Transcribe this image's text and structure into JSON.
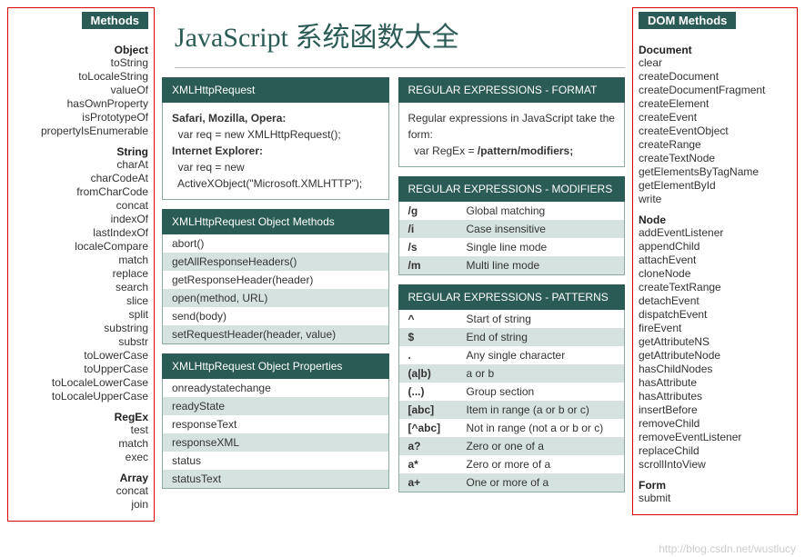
{
  "left_sidebar": {
    "header": "Methods",
    "groups": [
      {
        "title": "Object",
        "items": [
          "toString",
          "toLocaleString",
          "valueOf",
          "hasOwnProperty",
          "isPrototypeOf",
          "propertyIsEnumerable"
        ]
      },
      {
        "title": "String",
        "items": [
          "charAt",
          "charCodeAt",
          "fromCharCode",
          "concat",
          "indexOf",
          "lastIndexOf",
          "localeCompare",
          "match",
          "replace",
          "search",
          "slice",
          "split",
          "substring",
          "substr",
          "toLowerCase",
          "toUpperCase",
          "toLocaleLowerCase",
          "toLocaleUpperCase"
        ]
      },
      {
        "title": "RegEx",
        "items": [
          "test",
          "match",
          "exec"
        ]
      },
      {
        "title": "Array",
        "items": [
          "concat",
          "join"
        ]
      }
    ]
  },
  "right_sidebar": {
    "header": "DOM Methods",
    "groups": [
      {
        "title": "Document",
        "items": [
          "clear",
          "createDocument",
          "createDocumentFragment",
          "createElement",
          "createEvent",
          "createEventObject",
          "createRange",
          "createTextNode",
          "getElementsByTagName",
          "getElementById",
          "write"
        ]
      },
      {
        "title": "Node",
        "items": [
          "addEventListener",
          "appendChild",
          "attachEvent",
          "cloneNode",
          "createTextRange",
          "detachEvent",
          "dispatchEvent",
          "fireEvent",
          "getAttributeNS",
          "getAttributeNode",
          "hasChildNodes",
          "hasAttribute",
          "hasAttributes",
          "insertBefore",
          "removeChild",
          "removeEventListener",
          "replaceChild",
          "scrollIntoView"
        ]
      },
      {
        "title": "Form",
        "items": [
          "submit"
        ]
      }
    ]
  },
  "page_title": "JavaScript 系统函数大全",
  "left_col": {
    "xhr": {
      "header": "XMLHttpRequest",
      "lines": [
        {
          "bold": true,
          "text": "Safari, Mozilla, Opera:"
        },
        {
          "bold": false,
          "text": "  var req = new XMLHttpRequest();"
        },
        {
          "bold": true,
          "text": "Internet Explorer:"
        },
        {
          "bold": false,
          "text": "  var req = new"
        },
        {
          "bold": false,
          "text": "  ActiveXObject(\"Microsoft.XMLHTTP\");"
        }
      ]
    },
    "xhr_methods": {
      "header": "XMLHttpRequest Object Methods",
      "items": [
        "abort()",
        "getAllResponseHeaders()",
        "getResponseHeader(header)",
        "open(method, URL)",
        "send(body)",
        "setRequestHeader(header, value)"
      ]
    },
    "xhr_props": {
      "header": "XMLHttpRequest Object Properties",
      "items": [
        "onreadystatechange",
        "readyState",
        "responseText",
        "responseXML",
        "status",
        "statusText"
      ]
    }
  },
  "right_col": {
    "format": {
      "header": "REGULAR EXPRESSIONS - FORMAT",
      "line1": "Regular expressions in JavaScript take the form:",
      "line2_pre": "  var RegEx = ",
      "line2_bold": "/pattern/modifiers;"
    },
    "modifiers": {
      "header": "REGULAR EXPRESSIONS - MODIFIERS",
      "rows": [
        {
          "k": "/g",
          "v": "Global matching"
        },
        {
          "k": "/i",
          "v": "Case insensitive"
        },
        {
          "k": "/s",
          "v": "Single line mode"
        },
        {
          "k": "/m",
          "v": "Multi line mode"
        }
      ]
    },
    "patterns": {
      "header": "REGULAR EXPRESSIONS - PATTERNS",
      "rows": [
        {
          "k": "^",
          "v": "Start of string"
        },
        {
          "k": "$",
          "v": "End of string"
        },
        {
          "k": ".",
          "v": "Any single character"
        },
        {
          "k": "(a|b)",
          "v": "a or b"
        },
        {
          "k": "(...)",
          "v": "Group section"
        },
        {
          "k": "[abc]",
          "v": "Item in range (a or b or c)"
        },
        {
          "k": "[^abc]",
          "v": "Not in range (not a or b or c)"
        },
        {
          "k": "a?",
          "v": "Zero or one of a"
        },
        {
          "k": "a*",
          "v": "Zero or more of a"
        },
        {
          "k": "a+",
          "v": "One or more of a"
        }
      ]
    }
  },
  "watermark": "http://blog.csdn.net/wustlucy"
}
